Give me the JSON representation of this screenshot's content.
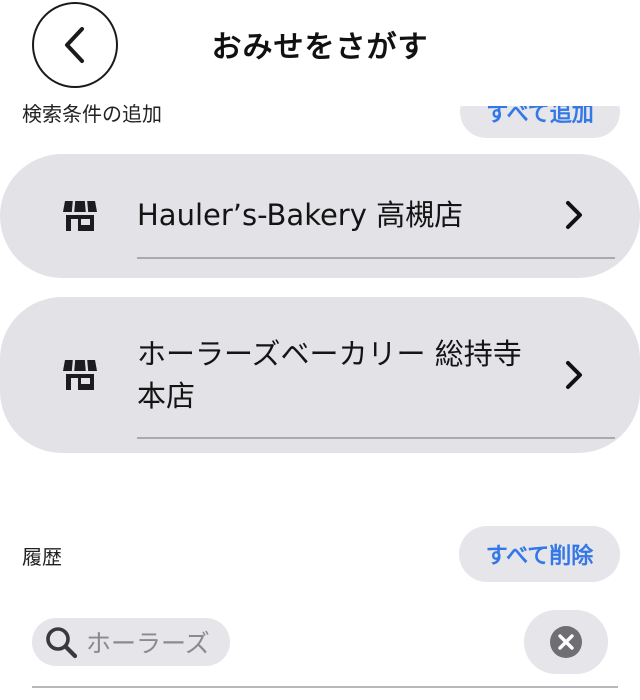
{
  "header": {
    "title": "おみせをさがす",
    "back_icon": "chevron-left-icon"
  },
  "conditions": {
    "label": "検索条件の追加",
    "add_all_label": "すべて追加"
  },
  "stores": [
    {
      "name": "Hauler’s-Bakery 高槻店",
      "icon": "store-icon"
    },
    {
      "name": "ホーラーズベーカリー 総持寺本店",
      "icon": "store-icon"
    }
  ],
  "history": {
    "label": "履歴",
    "delete_all_label": "すべて削除",
    "items": [
      {
        "query": "ホーラーズ",
        "icon": "search-icon"
      }
    ],
    "clear_icon": "clear-icon"
  },
  "colors": {
    "accent": "#3478e8",
    "row_background": "#e2e2e7",
    "chip_background": "#e5e5ea",
    "clear_circle": "#6e6e73"
  }
}
